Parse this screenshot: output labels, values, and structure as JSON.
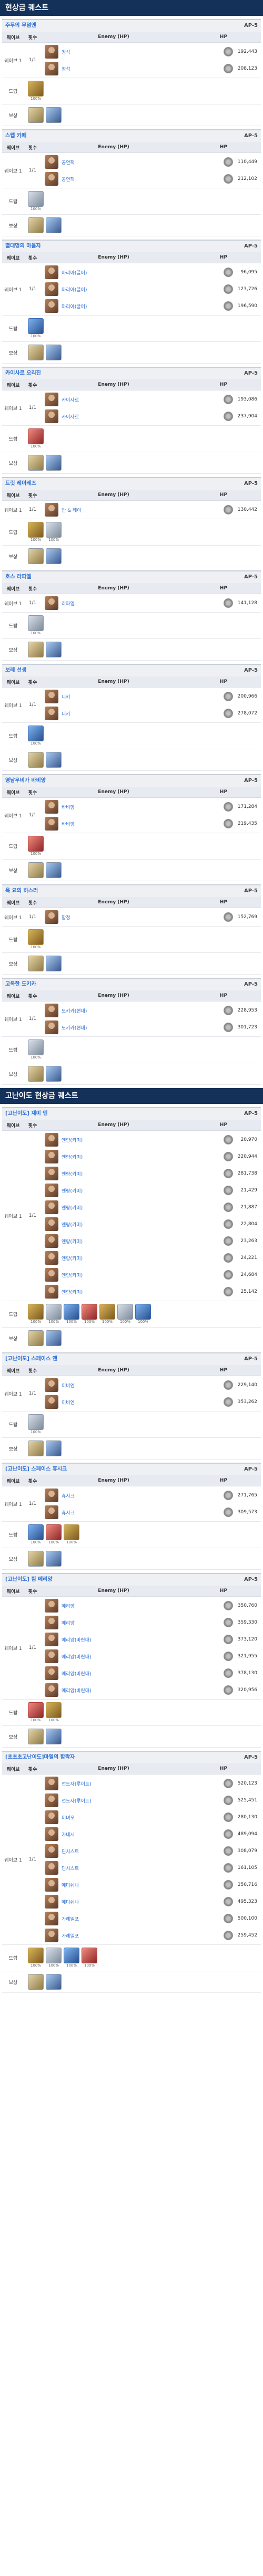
{
  "sections": [
    {
      "title": "현상금 퀘스트",
      "quests": [
        {
          "title": "주무의 무덤엔",
          "ap": "AP-5",
          "rows": [
            {
              "wave": "웨이브 1",
              "count": "1/1",
              "enemies": [
                {
                  "name": "정석",
                  "hp": "192,443"
                },
                {
                  "name": "정석",
                  "hp": "208,123"
                }
              ]
            }
          ],
          "drops": [
            {
              "pct": "100%"
            }
          ],
          "ba": 2
        },
        {
          "title": "스텝 카페",
          "ap": "AP-5",
          "rows": [
            {
              "wave": "웨이브 1",
              "count": "1/1",
              "enemies": [
                {
                  "name": "공연팩",
                  "hp": "110,449"
                },
                {
                  "name": "공연팩",
                  "hp": "212,102"
                }
              ]
            }
          ],
          "drops": [
            {
              "pct": "100%"
            }
          ],
          "ba": 2
        },
        {
          "title": "멸대명의 마을자",
          "ap": "AP-5",
          "rows": [
            {
              "wave": "웨이브 1",
              "count": "1/1",
              "enemies": [
                {
                  "name": "마리아(끌어)",
                  "hp": "96,095"
                },
                {
                  "name": "마리아(끌어)",
                  "hp": "123,726"
                },
                {
                  "name": "마리아(끌어)",
                  "hp": "196,590"
                }
              ]
            }
          ],
          "drops": [
            {
              "pct": "100%"
            }
          ],
          "ba": 2
        },
        {
          "title": "카이사르 오리진",
          "ap": "AP-5",
          "rows": [
            {
              "wave": "웨이브 1",
              "count": "1/1",
              "enemies": [
                {
                  "name": "카이사르",
                  "hp": "193,086"
                },
                {
                  "name": "카이사르",
                  "hp": "237,904"
                }
              ]
            }
          ],
          "drops": [
            {
              "pct": "100%"
            }
          ],
          "ba": 2
        },
        {
          "title": "트릿 레이레즈",
          "ap": "AP-5",
          "rows": [
            {
              "wave": "웨이브 1",
              "count": "1/1",
              "enemies": [
                {
                  "name": "반 & 레이",
                  "hp": "130,442"
                }
              ]
            }
          ],
          "drops": [
            {
              "pct": "100%"
            },
            {
              "pct": "100%"
            }
          ],
          "ba": 2
        },
        {
          "title": "호스 라파엘",
          "ap": "AP-5",
          "rows": [
            {
              "wave": "웨이브 1",
              "count": "1/1",
              "enemies": [
                {
                  "name": "라파엘",
                  "hp": "141,128"
                }
              ]
            }
          ],
          "drops": [
            {
              "pct": "100%"
            }
          ],
          "ba": 2
        },
        {
          "title": "보레 선생",
          "ap": "AP-5",
          "rows": [
            {
              "wave": "웨이브 1",
              "count": "1/1",
              "enemies": [
                {
                  "name": "니키",
                  "hp": "200,966"
                },
                {
                  "name": "니키",
                  "hp": "278,072"
                }
              ]
            }
          ],
          "drops": [
            {
              "pct": "100%"
            }
          ],
          "ba": 2
        },
        {
          "title": "영남우비가 바비앙",
          "ap": "AP-5",
          "rows": [
            {
              "wave": "웨이브 1",
              "count": "1/1",
              "enemies": [
                {
                  "name": "바비앙",
                  "hp": "171,284"
                },
                {
                  "name": "바비앙",
                  "hp": "219,435"
                }
              ]
            }
          ],
          "drops": [
            {
              "pct": "100%"
            }
          ],
          "ba": 2
        },
        {
          "title": "옥 요의 하스러",
          "ap": "AP-5",
          "rows": [
            {
              "wave": "웨이브 1",
              "count": "1/1",
              "enemies": [
                {
                  "name": "함정",
                  "hp": "152,769"
                }
              ]
            }
          ],
          "drops": [
            {
              "pct": "100%"
            }
          ],
          "ba": 2
        },
        {
          "title": "고독한 도키카",
          "ap": "AP-5",
          "rows": [
            {
              "wave": "웨이브 1",
              "count": "1/1",
              "enemies": [
                {
                  "name": "도키카(현대)",
                  "hp": "228,953"
                },
                {
                  "name": "도키카(현대)",
                  "hp": "301,723"
                }
              ]
            }
          ],
          "drops": [
            {
              "pct": "100%"
            }
          ],
          "ba": 2
        }
      ]
    },
    {
      "title": "고난이도 현상금 퀘스트",
      "quests": [
        {
          "title": "[고난이도] 재미 엔",
          "ap": "AP-5",
          "rows": [
            {
              "wave": "웨이브 1",
              "count": "1/1",
              "enemies": [
                {
                  "name": "엔량(카미)",
                  "hp": "20,970"
                },
                {
                  "name": "엔량(카미)",
                  "hp": "220,944"
                },
                {
                  "name": "엔량(카미)",
                  "hp": "281,738"
                },
                {
                  "name": "엔량(카미)",
                  "hp": "21,429"
                },
                {
                  "name": "엔량(카미)",
                  "hp": "21,887"
                },
                {
                  "name": "엔량(카미)",
                  "hp": "22,804"
                },
                {
                  "name": "엔량(카미)",
                  "hp": "23,263"
                },
                {
                  "name": "엔량(카미)",
                  "hp": "24,221"
                },
                {
                  "name": "엔량(카미)",
                  "hp": "24,684"
                },
                {
                  "name": "엔량(카미)",
                  "hp": "25,142"
                }
              ]
            }
          ],
          "drops": [
            {
              "pct": "100%"
            },
            {
              "pct": "100%"
            },
            {
              "pct": "100%"
            },
            {
              "pct": "100%"
            },
            {
              "pct": "100%"
            },
            {
              "pct": "100%"
            },
            {
              "pct": "100%"
            }
          ],
          "ba": 2
        },
        {
          "title": "[고난이도] 스페이스 엔",
          "ap": "AP-5",
          "rows": [
            {
              "wave": "웨이브 1",
              "count": "1/1",
              "enemies": [
                {
                  "name": "이비엔",
                  "hp": "229,140"
                },
                {
                  "name": "이비엔",
                  "hp": "353,262"
                }
              ]
            }
          ],
          "drops": [
            {
              "pct": "100%"
            }
          ],
          "ba": 2
        },
        {
          "title": "[고난이도] 스페이스 휴시크",
          "ap": "AP-5",
          "rows": [
            {
              "wave": "웨이브 1",
              "count": "1/1",
              "enemies": [
                {
                  "name": "휴시크",
                  "hp": "271,765"
                },
                {
                  "name": "휴시크",
                  "hp": "309,573"
                }
              ]
            }
          ],
          "drops": [
            {
              "pct": "100%"
            },
            {
              "pct": "100%"
            },
            {
              "pct": "100%"
            }
          ],
          "ba": 2
        },
        {
          "title": "[고난이도] 힘 메리앙",
          "ap": "AP-5",
          "rows": [
            {
              "wave": "웨이브 1",
              "count": "1/1",
              "enemies": [
                {
                  "name": "메리앙",
                  "hp": "350,760"
                },
                {
                  "name": "메리앙",
                  "hp": "359,330"
                },
                {
                  "name": "메리앙(바란대)",
                  "hp": "373,120"
                },
                {
                  "name": "메리앙(바란대)",
                  "hp": "321,955"
                },
                {
                  "name": "메리앙(바란대)",
                  "hp": "378,130"
                },
                {
                  "name": "메리앙(바란대)",
                  "hp": "320,956"
                }
              ]
            }
          ],
          "drops": [
            {
              "pct": "100%"
            },
            {
              "pct": "100%"
            }
          ],
          "ba": 2
        },
        {
          "title": "[초초초고난이도]마멜의 함락자",
          "ap": "AP-5",
          "rows": [
            {
              "wave": "웨이브 1",
              "count": "1/1",
              "enemies": [
                {
                  "name": "전도자(루이트)",
                  "hp": "520,123"
                },
                {
                  "name": "전도자(루이트)",
                  "hp": "525,451"
                },
                {
                  "name": "미녀오",
                  "hp": "280,130"
                },
                {
                  "name": "가네시",
                  "hp": "489,094"
                },
                {
                  "name": "딘시스트",
                  "hp": "308,079"
                },
                {
                  "name": "딘시스트",
                  "hp": "161,105"
                },
                {
                  "name": "메디쉬나",
                  "hp": "250,716"
                },
                {
                  "name": "메디쉬나",
                  "hp": "495,323"
                },
                {
                  "name": "가례밀포",
                  "hp": "500,100"
                },
                {
                  "name": "가례밀포",
                  "hp": "259,452"
                }
              ]
            }
          ],
          "drops": [
            {
              "pct": "100%"
            },
            {
              "pct": "100%"
            },
            {
              "pct": "100%"
            },
            {
              "pct": "100%"
            }
          ],
          "ba": 2
        }
      ]
    }
  ],
  "labels": {
    "wave": "웨이브",
    "count": "횟수",
    "enemy": "Enemy (HP)",
    "hp": "HP",
    "drop": "드랍",
    "ba": "보상"
  },
  "colors": {
    "header_bg": "#14315a",
    "accent": "#2d6fd6"
  },
  "icons": {
    "class": "class-icon",
    "portrait": "enemy-portrait",
    "drop": "drop-item-icon"
  }
}
